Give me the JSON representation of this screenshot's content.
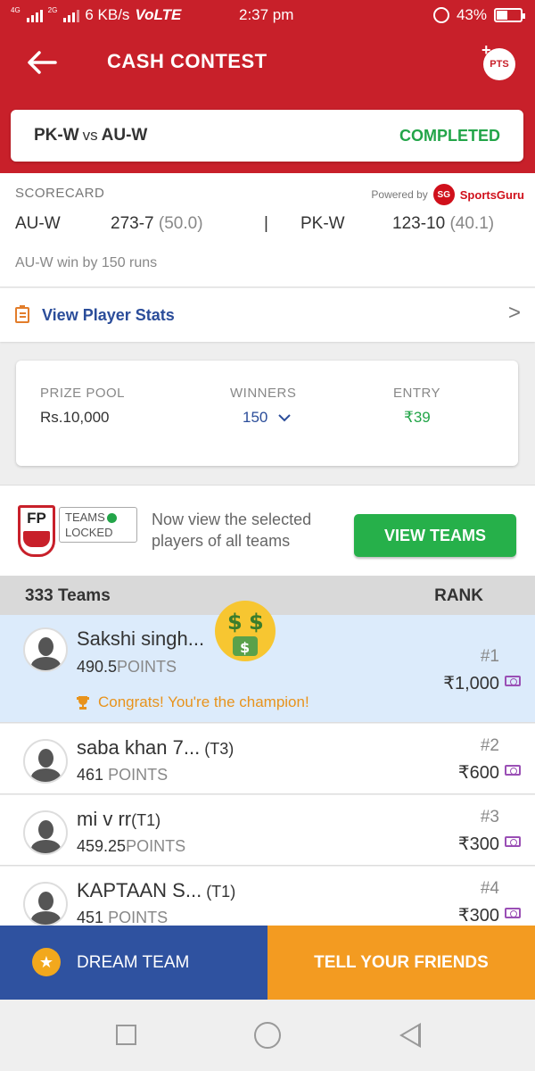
{
  "status_bar": {
    "network_a": "4G",
    "network_b": "2G",
    "speed": "6 KB/s",
    "volte": "VoLTE",
    "time": "2:37 pm",
    "battery": "43%",
    "battery_level": 0.43
  },
  "header": {
    "title": "CASH CONTEST",
    "pts_label": "PTS",
    "back_icon": "arrow-left-icon"
  },
  "match": {
    "team1": "PK-W",
    "vs": "vs",
    "team2": "AU-W",
    "status": "COMPLETED"
  },
  "scorecard": {
    "label": "SCORECARD",
    "powered_by": "Powered by",
    "provider_logo": "SG",
    "provider_name": "SportsGuru",
    "team_a": "AU-W",
    "team_a_score": "273-7",
    "team_a_overs": "(50.0)",
    "separator": "|",
    "team_b": "PK-W",
    "team_b_score": "123-10",
    "team_b_overs": "(40.1)",
    "result": "AU-W win by 150 runs"
  },
  "player_stats": {
    "label": "View Player Stats",
    "chevron": ">"
  },
  "prize": {
    "prize_pool_label": "PRIZE POOL",
    "prize_pool_value": "Rs.10,000",
    "winners_label": "WINNERS",
    "winners_value": "150",
    "entry_label": "ENTRY",
    "entry_value": "₹39"
  },
  "teams_locked": {
    "logo_text": "FP",
    "badge_line1": "TEAMS",
    "badge_line2": "LOCKED",
    "message": "Now view the selected players of all teams",
    "button": "VIEW TEAMS"
  },
  "leaderboard": {
    "teams_count": "333 Teams",
    "rank_label": "RANK",
    "rows": [
      {
        "name": "Sakshi singh...",
        "tag": "",
        "points": "490.5",
        "points_unit": "POINTS",
        "rank": "#1",
        "prize": "₹1,000",
        "congrats": "Congrats! You're the champion!"
      },
      {
        "name": "saba khan 7...",
        "tag": " (T3)",
        "points": "461",
        "points_unit": "POINTS",
        "rank": "#2",
        "prize": "₹600"
      },
      {
        "name": "mi v rr",
        "tag": "(T1)",
        "points": "459.25",
        "points_unit": "POINTS",
        "rank": "#3",
        "prize": "₹300"
      },
      {
        "name": "KAPTAAN S...",
        "tag": " (T1)",
        "points": "451",
        "points_unit": "POINTS",
        "rank": "#4",
        "prize": "₹300"
      }
    ]
  },
  "bottom_bar": {
    "dream_team": "DREAM TEAM",
    "tell_friends": "TELL YOUR FRIENDS"
  },
  "colors": {
    "brand_red": "#c8202a",
    "success_green": "#23a549",
    "link_blue": "#2b4d9a",
    "dream_team_blue": "#2f52a0",
    "tell_friends_orange": "#f39b21"
  }
}
